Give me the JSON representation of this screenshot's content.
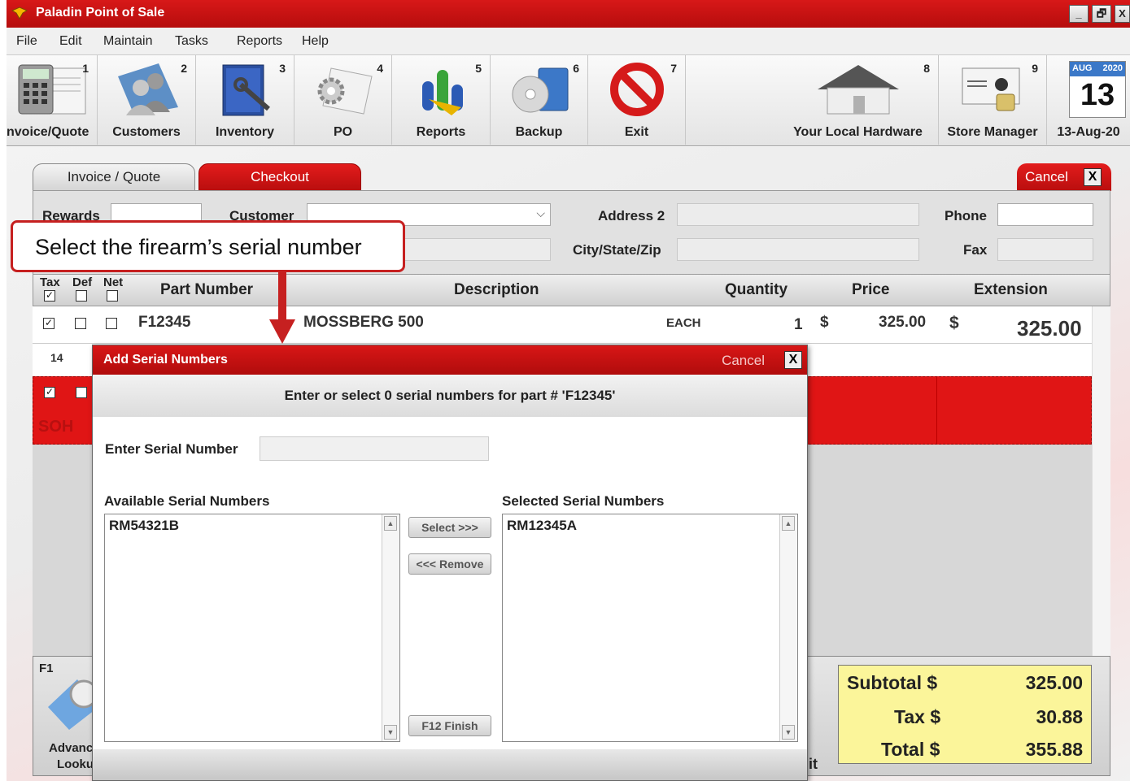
{
  "window": {
    "title": "Paladin Point of Sale",
    "controls": [
      "_",
      "🗗",
      "X"
    ]
  },
  "menu": [
    "File",
    "Edit",
    "Maintain",
    "Tasks",
    "Reports",
    "Help"
  ],
  "toolbar": [
    {
      "num": "1",
      "label": "nvoice/Quote",
      "icon": "invoice-icon"
    },
    {
      "num": "2",
      "label": "Customers",
      "icon": "customers-icon"
    },
    {
      "num": "3",
      "label": "Inventory",
      "icon": "inventory-icon"
    },
    {
      "num": "4",
      "label": "PO",
      "icon": "po-icon"
    },
    {
      "num": "5",
      "label": "Reports",
      "icon": "reports-icon"
    },
    {
      "num": "6",
      "label": "Backup",
      "icon": "backup-icon"
    },
    {
      "num": "7",
      "label": "Exit",
      "icon": "exit-icon"
    },
    {
      "num": "8",
      "label": "Your Local Hardware",
      "icon": "house-icon"
    },
    {
      "num": "9",
      "label": "Store Manager",
      "icon": "store-manager-icon"
    },
    {
      "month": "AUG",
      "year": "2020",
      "day": "13",
      "label": "13-Aug-20",
      "icon": "calendar-icon"
    }
  ],
  "tabs": {
    "invoice": "Invoice / Quote",
    "checkout": "Checkout",
    "cancel": "Cancel",
    "close": "X"
  },
  "form": {
    "rewards_label": "Rewards",
    "customer_label": "Customer",
    "address2_label": "Address 2",
    "city_label": "City/State/Zip",
    "phone_label": "Phone",
    "fax_label": "Fax"
  },
  "grid": {
    "headers": {
      "tax": "Tax",
      "def": "Def",
      "net": "Net",
      "part": "Part Number",
      "desc": "Description",
      "qty": "Quantity",
      "price": "Price",
      "ext": "Extension"
    },
    "row1": {
      "part": "F12345",
      "desc": "MOSSBERG 500",
      "unit": "EACH",
      "qty": "1",
      "price_cur": "$",
      "price": "325.00",
      "ext_cur": "$",
      "ext": "325.00"
    },
    "row2_num": "14",
    "row3_text": "SOH"
  },
  "bottom": {
    "f1": "F1",
    "lookup_label_1": "Advanc",
    "lookup_label_2": "Looku",
    "frag": "it"
  },
  "totals": {
    "subtotal_label": "Subtotal $",
    "subtotal": "325.00",
    "tax_label": "Tax $",
    "tax": "30.88",
    "total_label": "Total $",
    "total": "355.88"
  },
  "dialog": {
    "title": "Add Serial Numbers",
    "cancel": "Cancel",
    "close": "X",
    "instruction": "Enter or select 0 serial numbers for part # 'F12345'",
    "enter_label": "Enter Serial Number",
    "enter_value": "",
    "available_label": "Available Serial Numbers",
    "selected_label": "Selected Serial Numbers",
    "available": [
      "RM54321B"
    ],
    "selected": [
      "RM12345A"
    ],
    "select_btn": "Select >>>",
    "remove_btn": "<<< Remove",
    "finish_btn": "F12  Finish"
  },
  "callout": "Select the firearm’s serial number"
}
